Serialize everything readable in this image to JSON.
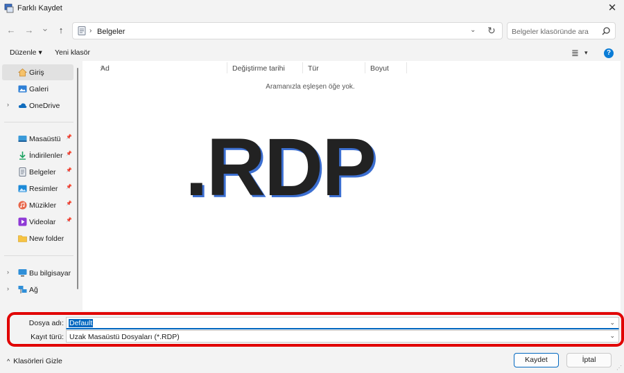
{
  "window": {
    "title": "Farklı Kaydet",
    "close_glyph": "✕"
  },
  "nav": {
    "back_glyph": "←",
    "forward_glyph": "→",
    "recent_glyph": "⌄",
    "up_glyph": "↑",
    "address_sep": "›",
    "address_text": "Belgeler",
    "address_chevron": "⌄",
    "refresh_glyph": "↻",
    "search_placeholder": "Belgeler klasöründe ara"
  },
  "toolbar": {
    "organize": "Düzenle ▾",
    "new_folder": "Yeni klasör",
    "view_glyph": "≣",
    "view_chevron": "▾",
    "help_glyph": "?"
  },
  "sidebar": {
    "items": [
      {
        "label": "Giriş",
        "icon": "home-icon",
        "selected": true
      },
      {
        "label": "Galeri",
        "icon": "gallery-icon"
      },
      {
        "label": "OneDrive",
        "icon": "cloud-icon",
        "expandable": true
      },
      {
        "label": "Masaüstü",
        "icon": "desktop-icon",
        "pinned": true
      },
      {
        "label": "İndirilenler",
        "icon": "download-icon",
        "pinned": true
      },
      {
        "label": "Belgeler",
        "icon": "document-icon",
        "pinned": true
      },
      {
        "label": "Resimler",
        "icon": "pictures-icon",
        "pinned": true
      },
      {
        "label": "Müzikler",
        "icon": "music-icon",
        "pinned": true
      },
      {
        "label": "Videolar",
        "icon": "video-icon",
        "pinned": true
      },
      {
        "label": "New folder",
        "icon": "folder-icon"
      },
      {
        "label": "Bu bilgisayar",
        "icon": "computer-icon",
        "expandable": true
      },
      {
        "label": "Ağ",
        "icon": "network-icon",
        "expandable": true
      }
    ],
    "arrow_glyph": "›",
    "pin_glyph": "📌"
  },
  "content": {
    "columns": [
      "Ad",
      "Değiştirme tarihi",
      "Tür",
      "Boyut"
    ],
    "sort_caret": "^",
    "empty_message": "Aramanızla eşleşen öğe yok.",
    "logo_text": ".RDP"
  },
  "file": {
    "name_label": "Dosya adı:",
    "name_value": "Default",
    "type_label": "Kayıt türü:",
    "type_value": "Uzak Masaüstü Dosyaları (*.RDP)",
    "chevron": "⌄"
  },
  "footer": {
    "hide_folders": "Klasörleri Gizle",
    "hide_caret": "^",
    "save": "Kaydet",
    "cancel": "İptal"
  },
  "colors": {
    "accent": "#0067c0",
    "highlight": "#e10000",
    "logo_shadow": "#3c6fd1"
  }
}
